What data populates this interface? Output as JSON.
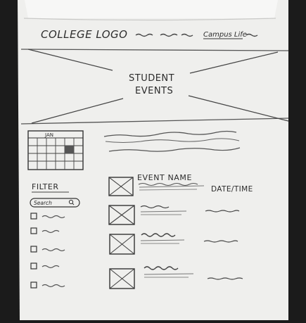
{
  "header": {
    "logo_text": "COLLEGE LOGO",
    "nav_link": "Campus Life"
  },
  "hero": {
    "title_line1": "STUDENT",
    "title_line2": "EVENTS"
  },
  "calendar": {
    "month": "JAN"
  },
  "filter": {
    "heading": "FILTER",
    "search_placeholder": "Search",
    "checkbox_count": 5
  },
  "events": {
    "name_label": "EVENT NAME",
    "datetime_label": "DATE/TIME",
    "items": [
      {
        "id": 1
      },
      {
        "id": 2
      },
      {
        "id": 3
      },
      {
        "id": 4
      }
    ]
  }
}
